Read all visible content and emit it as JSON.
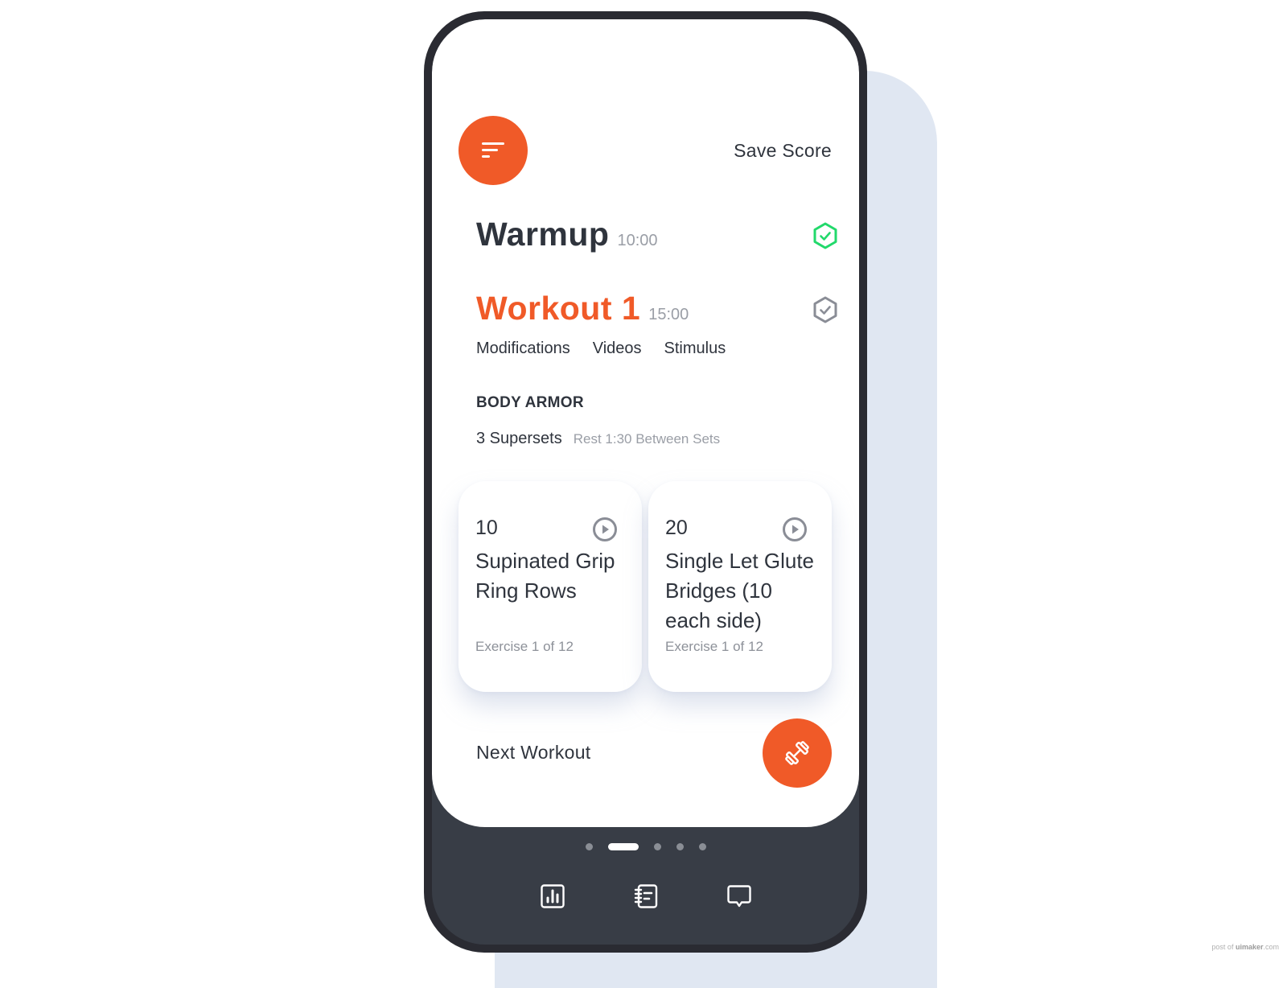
{
  "header": {
    "menu_icon": "filter-lines-icon",
    "save_score_label": "Save Score"
  },
  "sections": [
    {
      "title": "Warmup",
      "time": "10:00",
      "status": "completed",
      "status_icon": "hex-check-icon",
      "status_color": "#22d96b"
    },
    {
      "title": "Workout 1",
      "time": "15:00",
      "status": "pending",
      "status_icon": "hex-check-icon",
      "status_color": "#8a8d96"
    }
  ],
  "tabs": [
    "Modifications",
    "Videos",
    "Stimulus"
  ],
  "block": {
    "heading": "BODY ARMOR",
    "sets_label": "3 Supersets",
    "rest_label": "Rest 1:30 Between Sets"
  },
  "exercises": [
    {
      "count": "10",
      "name": "Supinated Grip Ring Rows",
      "meta": "Exercise 1 of 12",
      "icon": "play-circle-icon"
    },
    {
      "count": "20",
      "name": "Single Let Glute Bridges (10 each side)",
      "meta": "Exercise 1 of 12",
      "icon": "play-circle-icon"
    }
  ],
  "footer": {
    "next_label": "Next Workout",
    "next_icon": "dumbbell-icon"
  },
  "pager": {
    "total": 5,
    "active_index": 1
  },
  "bottom_nav": [
    {
      "name": "stats",
      "icon": "bar-chart-icon"
    },
    {
      "name": "notebook",
      "icon": "notebook-icon"
    },
    {
      "name": "messages",
      "icon": "chat-bubble-icon"
    }
  ],
  "colors": {
    "accent": "#f05a28",
    "text_dark": "#2f343d",
    "text_muted": "#9a9ea6",
    "success": "#22d96b",
    "frame": "#2a2b32",
    "nav_bg": "#383d46",
    "backdrop": "#e0e7f2"
  },
  "watermark": {
    "prefix": "post of ",
    "brand": "uimaker",
    "suffix": ".com"
  }
}
